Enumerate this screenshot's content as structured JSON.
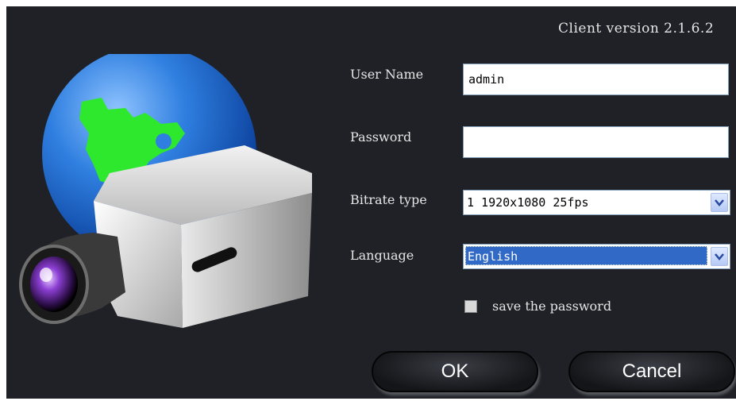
{
  "version_label": "Client version 2.1.6.2",
  "form": {
    "username_label": "User Name",
    "username_value": "admin",
    "password_label": "Password",
    "password_value": "",
    "bitrate_label": "Bitrate type",
    "bitrate_value": "1 1920x1080 25fps",
    "language_label": "Language",
    "language_value": "English",
    "save_password_label": "save the password",
    "save_password_checked": false
  },
  "buttons": {
    "ok": "OK",
    "cancel": "Cancel"
  },
  "colors": {
    "background": "#1f2126",
    "selection": "#3169c6",
    "globe": "#2f7fe0",
    "land": "#2ee82e"
  },
  "icons": {
    "illustration": "camera-globe-icon",
    "dropdown": "chevron-down-icon"
  }
}
